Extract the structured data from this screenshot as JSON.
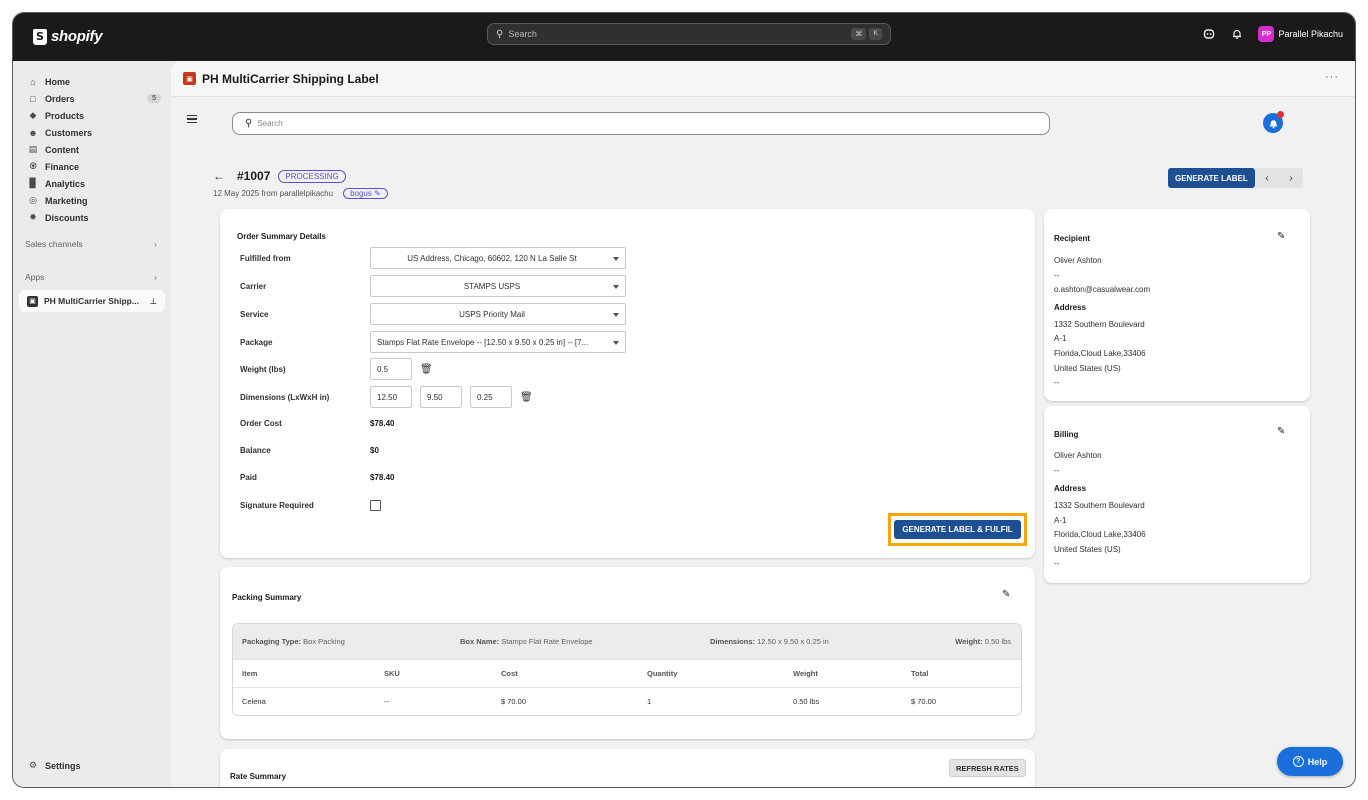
{
  "brand": {
    "name": "shopify"
  },
  "topbar": {
    "search_placeholder": "Search",
    "shortcut_keys": [
      "⌘",
      "K"
    ],
    "user_initials": "PP",
    "user_name": "Parallel Pikachu"
  },
  "sidebar": {
    "items": [
      {
        "label": "Home",
        "icon": "home-icon"
      },
      {
        "label": "Orders",
        "icon": "orders-icon",
        "badge": "5"
      },
      {
        "label": "Products",
        "icon": "tag-icon"
      },
      {
        "label": "Customers",
        "icon": "person-icon"
      },
      {
        "label": "Content",
        "icon": "content-icon"
      },
      {
        "label": "Finance",
        "icon": "bank-icon"
      },
      {
        "label": "Analytics",
        "icon": "chart-icon"
      },
      {
        "label": "Marketing",
        "icon": "target-icon"
      },
      {
        "label": "Discounts",
        "icon": "discount-icon"
      }
    ],
    "sales_channels": "Sales channels",
    "apps": "Apps",
    "app_item": "PH MultiCarrier Shipp...",
    "settings": "Settings"
  },
  "app": {
    "title": "PH MultiCarrier Shipping Label",
    "search_placeholder": "Search"
  },
  "order": {
    "number": "#1007",
    "status": "PROCESSING",
    "meta": "12 May 2025 from parallelpikachu",
    "tag": "bogus",
    "generate_label": "GENERATE LABEL"
  },
  "summary": {
    "title": "Order Summary Details",
    "fulfilled_from_label": "Fulfilled from",
    "fulfilled_from": "US Address, Chicago, 60602, 120 N La Salle St",
    "carrier_label": "Carrier",
    "carrier": "STAMPS USPS",
    "service_label": "Service",
    "service": "USPS Priority Mail",
    "package_label": "Package",
    "package": "Stamps Flat Rate Envelope -- [12.50 x 9.50 x 0.25 in] -- [7...",
    "weight_label": "Weight  (lbs)",
    "weight": "0.5",
    "dimensions_label": "Dimensions (LxWxH in)",
    "length": "12.50",
    "width": "9.50",
    "height": "0.25",
    "order_cost_label": "Order Cost",
    "order_cost": "$78.40",
    "balance_label": "Balance",
    "balance": "$0",
    "paid_label": "Paid",
    "paid": "$78.40",
    "signature_label": "Signature Required",
    "signature_required": false,
    "generate_fulfil": "GENERATE LABEL & FULFIL"
  },
  "packing": {
    "title": "Packing Summary",
    "packaging_type_label": "Packaging Type:",
    "packaging_type": "Box Packing",
    "box_name_label": "Box Name:",
    "box_name": "Stamps Flat Rate Envelope",
    "dimensions_label": "Dimensions:",
    "dimensions": "12.50 x 9.50 x 0.25 in",
    "weight_label": "Weight:",
    "weight": "0.50 lbs",
    "columns": [
      "Item",
      "SKU",
      "Cost",
      "Quantity",
      "Weight",
      "Total"
    ],
    "rows": [
      [
        "Celena",
        "--",
        "$ 70.00",
        "1",
        "0.50 lbs",
        "$ 70.00"
      ]
    ]
  },
  "rate": {
    "title": "Rate Summary",
    "refresh": "REFRESH RATES"
  },
  "recipient": {
    "title": "Recipient",
    "name": "Oliver Ashton",
    "phone": "--",
    "email": "o.ashton@casualwear.com",
    "address_label": "Address",
    "line1": "1332 Southern Boulevard",
    "line2": "A-1",
    "line3": "Florida,Cloud Lake,33406",
    "country": "United States (US)",
    "extra": "--"
  },
  "billing": {
    "title": "Billing",
    "name": "Oliver Ashton",
    "phone": "--",
    "address_label": "Address",
    "line1": "1332 Southern Boulevard",
    "line2": "A-1",
    "line3": "Florida,Cloud Lake,33406",
    "country": "United States (US)",
    "extra": "--"
  },
  "help": {
    "label": "Help"
  },
  "colors": {
    "primary_button": "#1d4f94",
    "highlight": "#f6a60c",
    "accent": "#5a4fd8",
    "help": "#1a6fdd"
  }
}
